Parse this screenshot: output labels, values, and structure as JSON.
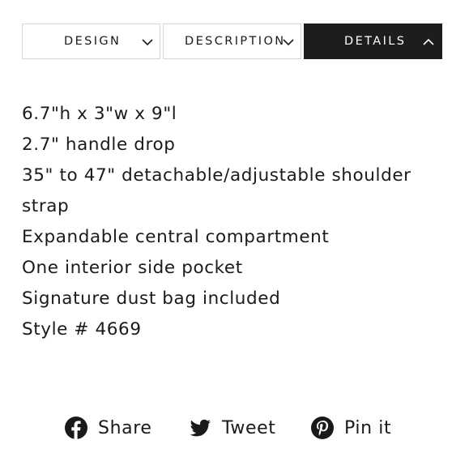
{
  "tabs": [
    {
      "label": "DESIGN",
      "icon": "chevron-down-icon",
      "active": false
    },
    {
      "label": "DESCRIPTION",
      "icon": "chevron-down-icon",
      "active": false
    },
    {
      "label": "DETAILS",
      "icon": "chevron-up-icon",
      "active": true
    }
  ],
  "details": {
    "lines": [
      "6.7\"h x 3\"w x 9\"l",
      "2.7\" handle drop",
      "35\" to 47\" detachable/adjustable shoulder strap",
      "Expandable central compartment",
      "One interior side pocket",
      "Signature dust bag included",
      "Style # 4669"
    ]
  },
  "share": {
    "facebook": {
      "label": "Share",
      "icon": "facebook-icon"
    },
    "twitter": {
      "label": "Tweet",
      "icon": "twitter-icon"
    },
    "pinterest": {
      "label": "Pin it",
      "icon": "pinterest-icon"
    }
  },
  "colors": {
    "active_tab_bg": "#1d1d1d",
    "text": "#1a1a1a",
    "tab_border": "#d6d6d6"
  }
}
